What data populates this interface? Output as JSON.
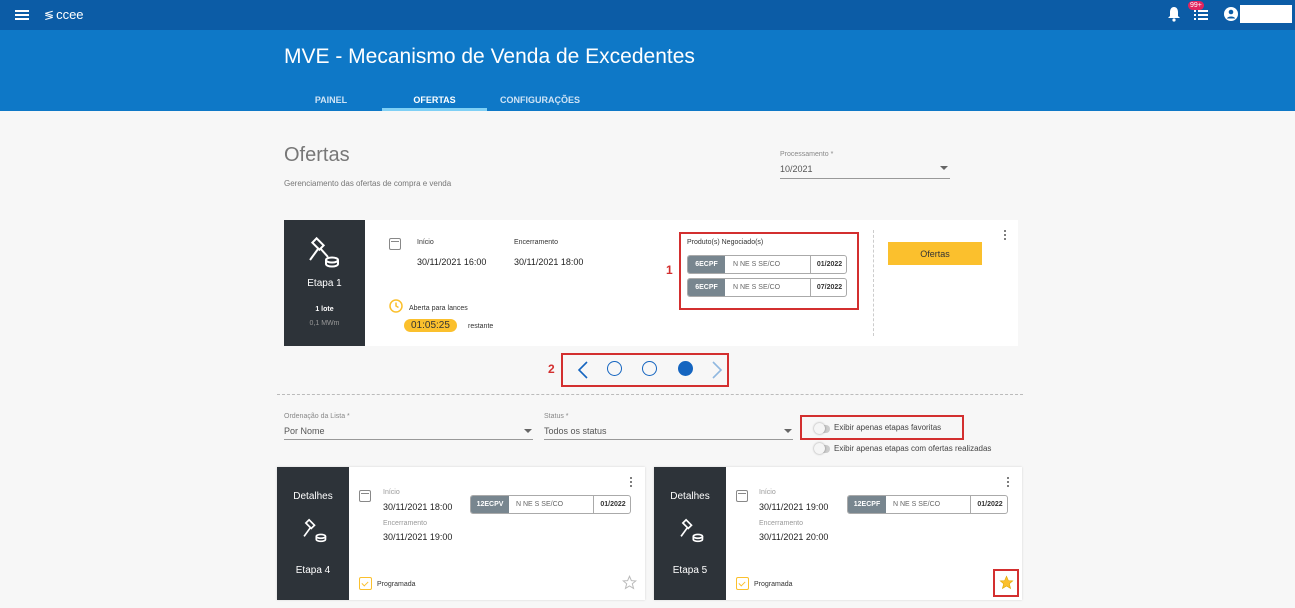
{
  "topbar": {
    "logo_text": "ccee",
    "tasks_badge": "99+"
  },
  "header": {
    "title": "MVE - Mecanismo de Venda de Excedentes",
    "tabs": [
      {
        "label": "PAINEL"
      },
      {
        "label": "OFERTAS"
      },
      {
        "label": "CONFIGURAÇÕES"
      }
    ]
  },
  "page": {
    "title": "Ofertas",
    "subtitle": "Gerenciamento das ofertas de compra e venda",
    "processamento": {
      "label": "Processamento *",
      "value": "10/2021"
    }
  },
  "main_card": {
    "stage_name": "Etapa 1",
    "lote": "1 lote",
    "power": "0,1 MWm",
    "inicio_label": "Início",
    "inicio_value": "30/11/2021 16:00",
    "encerramento_label": "Encerramento",
    "encerramento_value": "30/11/2021 18:00",
    "status_text": "Aberta para lances",
    "timer": "01:05:25",
    "timer_suffix": "restante",
    "products_title": "Produto(s) Negociado(s)",
    "products": [
      {
        "code": "6ECPF",
        "subs": "N   NE   S   SE/CO",
        "date": "01/2022"
      },
      {
        "code": "6ECPF",
        "subs": "N   NE   S   SE/CO",
        "date": "07/2022"
      }
    ],
    "button_label": "Ofertas",
    "annotation": "1"
  },
  "pager": {
    "annotation": "2",
    "prev": "‹",
    "next": "›"
  },
  "filters": {
    "ordenacao": {
      "label": "Ordenação da Lista *",
      "value": "Por Nome"
    },
    "status": {
      "label": "Status *",
      "value": "Todos os status"
    },
    "toggle_favoritas": "Exibir apenas etapas favoritas",
    "toggle_ofertas": "Exibir apenas etapas com ofertas realizadas"
  },
  "stage_cards": [
    {
      "details_label": "Detalhes",
      "stage_name": "Etapa 4",
      "inicio_label": "Início",
      "inicio_value": "30/11/2021 18:00",
      "encerramento_label": "Encerramento",
      "encerramento_value": "30/11/2021 19:00",
      "product_code": "12ECPV",
      "product_subs": "N   NE   S   SE/CO",
      "product_date": "01/2022",
      "status": "Programada",
      "favorite": false
    },
    {
      "details_label": "Detalhes",
      "stage_name": "Etapa 5",
      "inicio_label": "Início",
      "inicio_value": "30/11/2021 19:00",
      "encerramento_label": "Encerramento",
      "encerramento_value": "30/11/2021 20:00",
      "product_code": "12ECPF",
      "product_subs": "N   NE   S   SE/CO",
      "product_date": "01/2022",
      "status": "Programada",
      "favorite": true
    }
  ],
  "colors": {
    "topbar": "#0c5ca6",
    "header": "#0e78c7",
    "accent_yellow": "#fbc02d",
    "annotation_red": "#d32f2f",
    "dark_panel": "#2d3339"
  }
}
